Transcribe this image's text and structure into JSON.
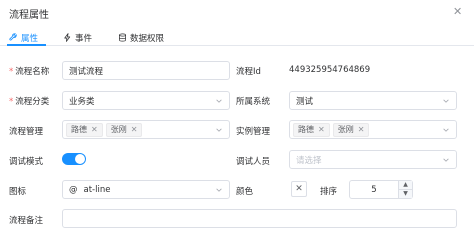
{
  "panel": {
    "title": "流程属性"
  },
  "tabs": [
    {
      "label": "属性",
      "icon": "wrench-icon"
    },
    {
      "label": "事件",
      "icon": "lightning-icon"
    },
    {
      "label": "数据权限",
      "icon": "database-icon"
    }
  ],
  "form": {
    "name": {
      "label": "流程名称",
      "value": "测试流程"
    },
    "id": {
      "label": "流程Id",
      "value": "449325954764869"
    },
    "category": {
      "label": "流程分类",
      "value": "业务类"
    },
    "system": {
      "label": "所属系统",
      "value": "测试"
    },
    "managers": {
      "label": "流程管理",
      "tags": [
        "路德",
        "张刚"
      ]
    },
    "instance_managers": {
      "label": "实例管理",
      "tags": [
        "路德",
        "张刚"
      ]
    },
    "debug": {
      "label": "调试模式",
      "on": true
    },
    "debuggers": {
      "label": "调试人员",
      "placeholder": "请选择"
    },
    "icon": {
      "label": "图标",
      "glyph": "@",
      "value": "at-line"
    },
    "color": {
      "label": "颜色",
      "symbol": "✕"
    },
    "order": {
      "label": "排序",
      "value": "5"
    },
    "remark": {
      "label": "流程备注",
      "value": ""
    }
  },
  "colors": {
    "accent": "#1890ff",
    "required": "#f56c6c",
    "border": "#dcdfe6"
  }
}
